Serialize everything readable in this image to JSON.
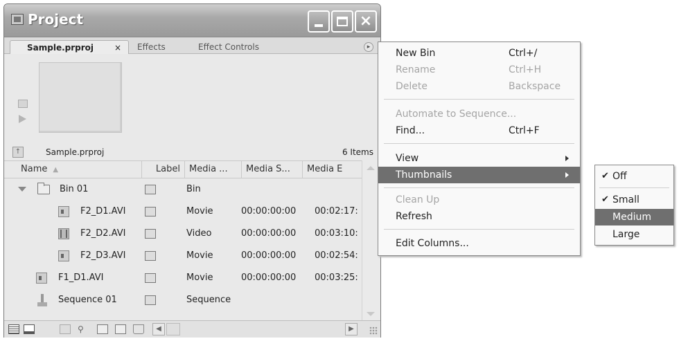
{
  "window": {
    "title": "Project",
    "tabs": [
      {
        "label": "Sample.prproj",
        "close": "×"
      },
      {
        "label": "Effects"
      },
      {
        "label": "Effect Controls"
      }
    ],
    "panel_menu_glyph": "▸"
  },
  "project": {
    "name": "Sample.prproj",
    "count": "6 Items"
  },
  "columns": [
    "Name",
    "Label",
    "Media ...",
    "Media S...",
    "Media E"
  ],
  "rows": [
    {
      "name": "Bin 01",
      "type": "Bin",
      "start": "",
      "end": ""
    },
    {
      "name": "F2_D1.AVI",
      "type": "Movie",
      "start": "00:00:00:00",
      "end": "00:02:17:"
    },
    {
      "name": "F2_D2.AVI",
      "type": "Video",
      "start": "00:00:00:00",
      "end": "00:03:10:"
    },
    {
      "name": "F2_D3.AVI",
      "type": "Movie",
      "start": "00:00:00:00",
      "end": "00:02:54:"
    },
    {
      "name": "F1_D1.AVI",
      "type": "Movie",
      "start": "00:00:00:00",
      "end": "00:03:25:"
    },
    {
      "name": "Sequence 01",
      "type": "Sequence",
      "start": "",
      "end": ""
    }
  ],
  "menu": {
    "items": [
      {
        "label": "New Bin",
        "shortcut": "Ctrl+/",
        "disabled": false
      },
      {
        "label": "Rename",
        "shortcut": "Ctrl+H",
        "disabled": true
      },
      {
        "label": "Delete",
        "shortcut": "Backspace",
        "disabled": true
      },
      {
        "label": "Automate to Sequence...",
        "shortcut": "",
        "disabled": true
      },
      {
        "label": "Find...",
        "shortcut": "Ctrl+F",
        "disabled": false
      },
      {
        "label": "View",
        "shortcut": "",
        "disabled": false
      },
      {
        "label": "Thumbnails",
        "shortcut": "",
        "disabled": false
      },
      {
        "label": "Clean Up",
        "shortcut": "",
        "disabled": true
      },
      {
        "label": "Refresh",
        "shortcut": "",
        "disabled": false
      },
      {
        "label": "Edit Columns...",
        "shortcut": "",
        "disabled": false
      }
    ]
  },
  "submenu": {
    "items": [
      {
        "label": "Off",
        "checked": true
      },
      {
        "label": "Small",
        "checked": true
      },
      {
        "label": "Medium",
        "checked": false
      },
      {
        "label": "Large",
        "checked": false
      }
    ],
    "check_glyph": "✔"
  },
  "colors": {
    "highlight": "#6f6f6f",
    "disabled_text": "#a5a5a5"
  }
}
